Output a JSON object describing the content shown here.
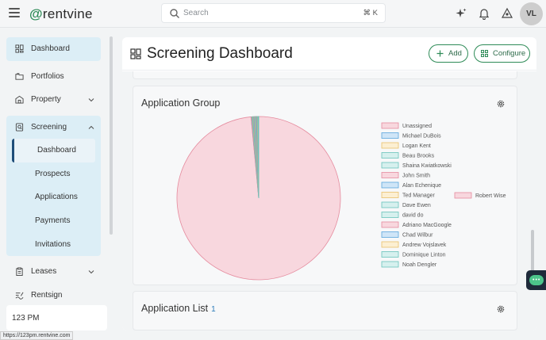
{
  "app": {
    "logo_text": "rentvine",
    "logo_mark": "@"
  },
  "search": {
    "placeholder": "Search",
    "shortcut": "⌘ K"
  },
  "user": {
    "initials": "VL"
  },
  "sidebar": {
    "items": [
      {
        "label": "Dashboard",
        "icon": "dashboard-icon"
      },
      {
        "label": "Portfolios",
        "icon": "folders-icon"
      },
      {
        "label": "Property",
        "icon": "building-icon"
      },
      {
        "label": "Screening",
        "icon": "screening-icon"
      },
      {
        "label": "Leases",
        "icon": "clipboard-icon"
      },
      {
        "label": "Rentsign",
        "icon": "signature-icon"
      }
    ],
    "screening_sub": [
      {
        "label": "Dashboard"
      },
      {
        "label": "Prospects"
      },
      {
        "label": "Applications"
      },
      {
        "label": "Payments"
      },
      {
        "label": "Invitations"
      }
    ],
    "status_text": "123 PM"
  },
  "status_url": "https://123pm.rentvine.com",
  "page": {
    "title": "Screening Dashboard",
    "add_label": "Add",
    "configure_label": "Configure"
  },
  "cards": {
    "application_group": {
      "title": "Application Group"
    },
    "application_list": {
      "title": "Application List",
      "count": "1"
    }
  },
  "colors": {
    "accent": "#2e8b57",
    "pie_main": "#f8d7de",
    "pie_border": "#e58b9e"
  },
  "chart_data": {
    "type": "pie",
    "title": "Application Group",
    "legend_position": "right",
    "labels": [
      "Unassigned",
      "Michael DuBois",
      "Logan Kent",
      "Beau Brooks",
      "Shaina Kwiatkowski",
      "John Smith",
      "Alan Echenique",
      "Ted Manager",
      "Dave Ewen",
      "david do",
      "Adriano MacGoogle",
      "Chad Wilbur",
      "Andrew Vojslavek",
      "Dominique Linton",
      "Noah Dengler",
      "Robert Wise"
    ],
    "values": [
      0.1,
      0.1,
      0.1,
      0.1,
      0.1,
      0.1,
      0.1,
      0.1,
      0.1,
      0.1,
      0.1,
      0.1,
      0.1,
      0.1,
      0.1,
      98.5
    ],
    "colors": [
      "#f8d7de",
      "#cfe5f7",
      "#fcefd2",
      "#d6f0ee",
      "#d6f0ee",
      "#f8d7de",
      "#cfe5f7",
      "#fcefd2",
      "#d6f0ee",
      "#d6f0ee",
      "#f8d7de",
      "#cfe5f7",
      "#fcefd2",
      "#d6f0ee",
      "#d6f0ee",
      "#f8d7de"
    ],
    "borders": [
      "#e58b9e",
      "#5aa5dc",
      "#e9c06a",
      "#69c3bb",
      "#69c3bb",
      "#e58b9e",
      "#5aa5dc",
      "#e9c06a",
      "#69c3bb",
      "#69c3bb",
      "#e58b9e",
      "#5aa5dc",
      "#e9c06a",
      "#69c3bb",
      "#69c3bb",
      "#e58b9e"
    ]
  }
}
